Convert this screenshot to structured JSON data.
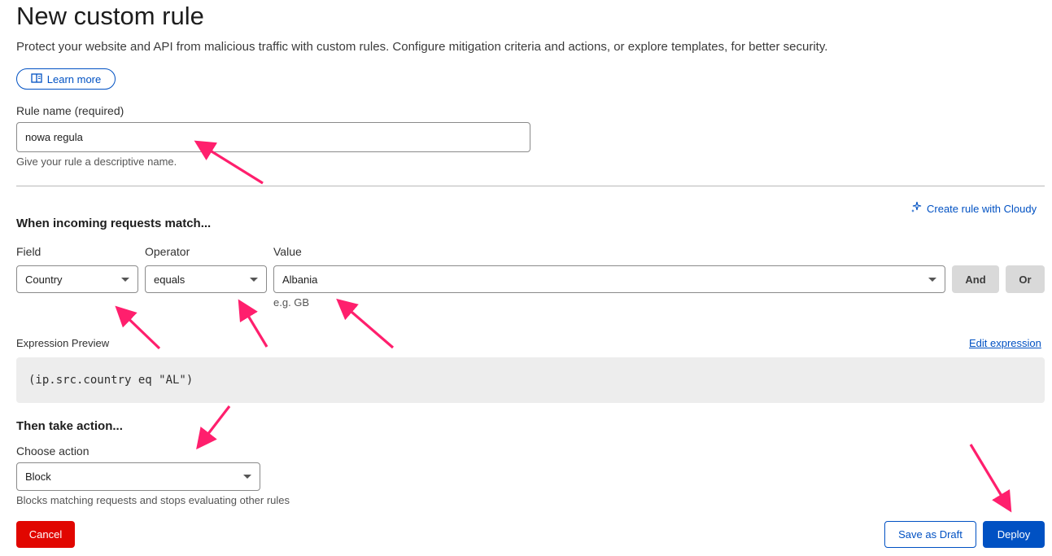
{
  "header": {
    "title": "New custom rule",
    "description": "Protect your website and API from malicious traffic with custom rules. Configure mitigation criteria and actions, or explore templates, for better security.",
    "learn_more_label": "Learn more"
  },
  "rule_name": {
    "label": "Rule name (required)",
    "value": "nowa regula",
    "help": "Give your rule a descriptive name."
  },
  "match": {
    "heading": "When incoming requests match...",
    "cloudy_link": "Create rule with Cloudy",
    "field_label": "Field",
    "field_value": "Country",
    "operator_label": "Operator",
    "operator_value": "equals",
    "value_label": "Value",
    "value_value": "Albania",
    "value_hint": "e.g. GB",
    "and_label": "And",
    "or_label": "Or"
  },
  "expression": {
    "label": "Expression Preview",
    "edit_link": "Edit expression",
    "text": "(ip.src.country eq \"AL\")"
  },
  "action": {
    "heading": "Then take action...",
    "label": "Choose action",
    "value": "Block",
    "help": "Blocks matching requests and stops evaluating other rules"
  },
  "footer": {
    "cancel_label": "Cancel",
    "draft_label": "Save as Draft",
    "deploy_label": "Deploy"
  },
  "colors": {
    "accent": "#0051c3",
    "danger": "#e10600",
    "annotation_arrow": "#ff1f6d"
  },
  "icons": [
    "book-icon",
    "sparkle-icon",
    "chevron-down-icon"
  ]
}
